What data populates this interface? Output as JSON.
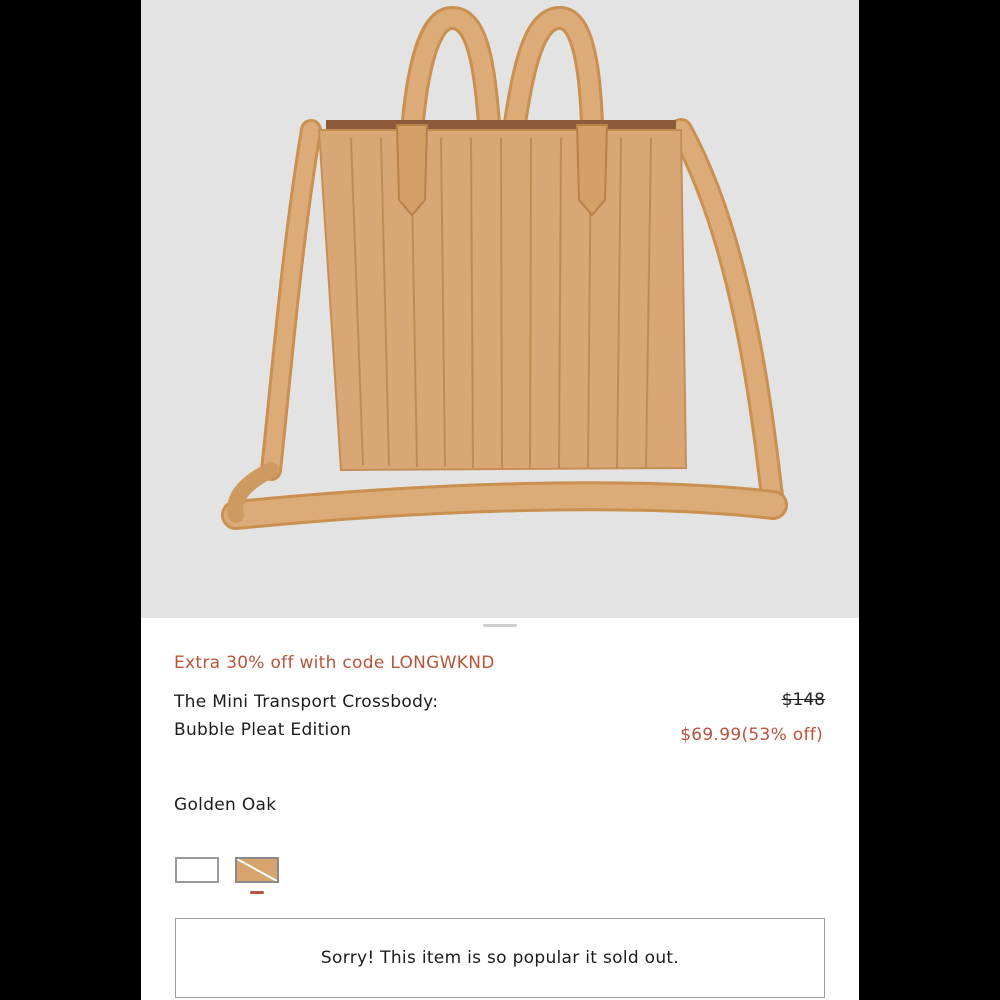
{
  "product": {
    "promo": "Extra 30% off with code LONGWKND",
    "name_line1": "The Mini Transport Crossbody:",
    "name_line2": "Bubble Pleat Edition",
    "original_price": "$148",
    "sale_price": "$69.99(53% off)",
    "selected_color": "Golden Oak",
    "swatches": [
      {
        "color": "#ffffff",
        "selected": false
      },
      {
        "color": "#d7a46d",
        "selected": true,
        "unavailable": true
      }
    ],
    "soldout_message": "Sorry! This item is so popular it sold out."
  },
  "colors": {
    "accent": "#b8543a",
    "bag": "#d9a775",
    "hero_bg": "#e3e3e3"
  }
}
